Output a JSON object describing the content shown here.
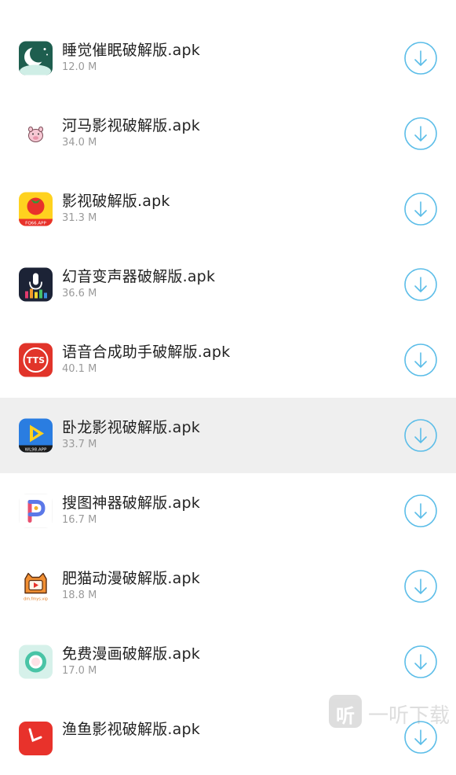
{
  "items": [
    {
      "title": "睡觉催眠破解版.apk",
      "size": "12.0 M",
      "icon": "moon-sleep-icon"
    },
    {
      "title": "河马影视破解版.apk",
      "size": "34.0 M",
      "icon": "pink-pig-icon"
    },
    {
      "title": "影视破解版.apk",
      "size": "31.3 M",
      "icon": "tomato-icon",
      "icon_text": "FQ66.APP"
    },
    {
      "title": "幻音变声器破解版.apk",
      "size": "36.6 M",
      "icon": "microphone-icon"
    },
    {
      "title": "语音合成助手破解版.apk",
      "size": "40.1 M",
      "icon": "tts-icon",
      "icon_text": "TTS"
    },
    {
      "title": "卧龙影视破解版.apk",
      "size": "33.7 M",
      "icon": "play-icon",
      "icon_text": "WL98.APP",
      "highlighted": true
    },
    {
      "title": "搜图神器破解版.apk",
      "size": "16.7 M",
      "icon": "letter-p-icon"
    },
    {
      "title": "肥猫动漫破解版.apk",
      "size": "18.8 M",
      "icon": "cat-tv-icon",
      "icon_text": "dm.fmys.vip"
    },
    {
      "title": "免费漫画破解版.apk",
      "size": "17.0 M",
      "icon": "ring-icon"
    },
    {
      "title": "渔鱼影视破解版.apk",
      "size": "",
      "icon": "red-app-icon"
    }
  ],
  "watermark": {
    "icon_glyph": "听",
    "text": "一听下载"
  },
  "colors": {
    "accent": "#5bbde8",
    "title": "#222222",
    "size": "#9a9a9a",
    "highlight": "#efefef"
  }
}
